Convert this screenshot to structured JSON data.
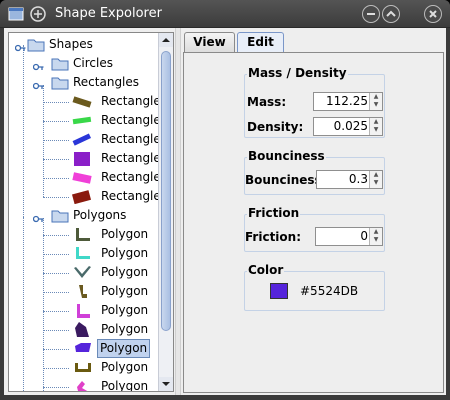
{
  "window": {
    "title": "Shape Expolorer"
  },
  "tree": {
    "root": "Shapes",
    "circles": "Circles",
    "rectangles": "Rectangles",
    "rectangle_items": [
      {
        "label": "Rectangle",
        "color": "#6B5A1E"
      },
      {
        "label": "Rectangle",
        "color": "#39D849"
      },
      {
        "label": "Rectangle",
        "color": "#2A36D8"
      },
      {
        "label": "Rectangle",
        "color": "#8A1FC8"
      },
      {
        "label": "Rectangle",
        "color": "#F040D8"
      },
      {
        "label": "Rectangle",
        "color": "#8A1A0E"
      }
    ],
    "polygons": "Polygons",
    "polygon_items": [
      {
        "label": "Polygon",
        "color": "#4E5A3A"
      },
      {
        "label": "Polygon",
        "color": "#40D8C8"
      },
      {
        "label": "Polygon",
        "color": "#4A6A6A"
      },
      {
        "label": "Polygon",
        "color": "#6A5A20"
      },
      {
        "label": "Polygon",
        "color": "#D040D8"
      },
      {
        "label": "Polygon",
        "color": "#3A1A60"
      },
      {
        "label": "Polygon",
        "color": "#5524DB",
        "selected": true
      },
      {
        "label": "Polygon",
        "color": "#6A5A10"
      },
      {
        "label": "Polygon",
        "color": "#E040C8"
      }
    ]
  },
  "tabs": {
    "view": "View",
    "edit": "Edit"
  },
  "mass_density": {
    "title": "Mass / Density",
    "mass_label": "Mass:",
    "mass_value": "112.25",
    "density_label": "Density:",
    "density_value": "0.025"
  },
  "bounciness": {
    "title": "Bounciness",
    "label": "Bounciness:",
    "value": "0.3"
  },
  "friction": {
    "title": "Friction",
    "label": "Friction:",
    "value": "0"
  },
  "color": {
    "title": "Color",
    "hex": "#5524DB",
    "swatch": "#5524DB"
  }
}
